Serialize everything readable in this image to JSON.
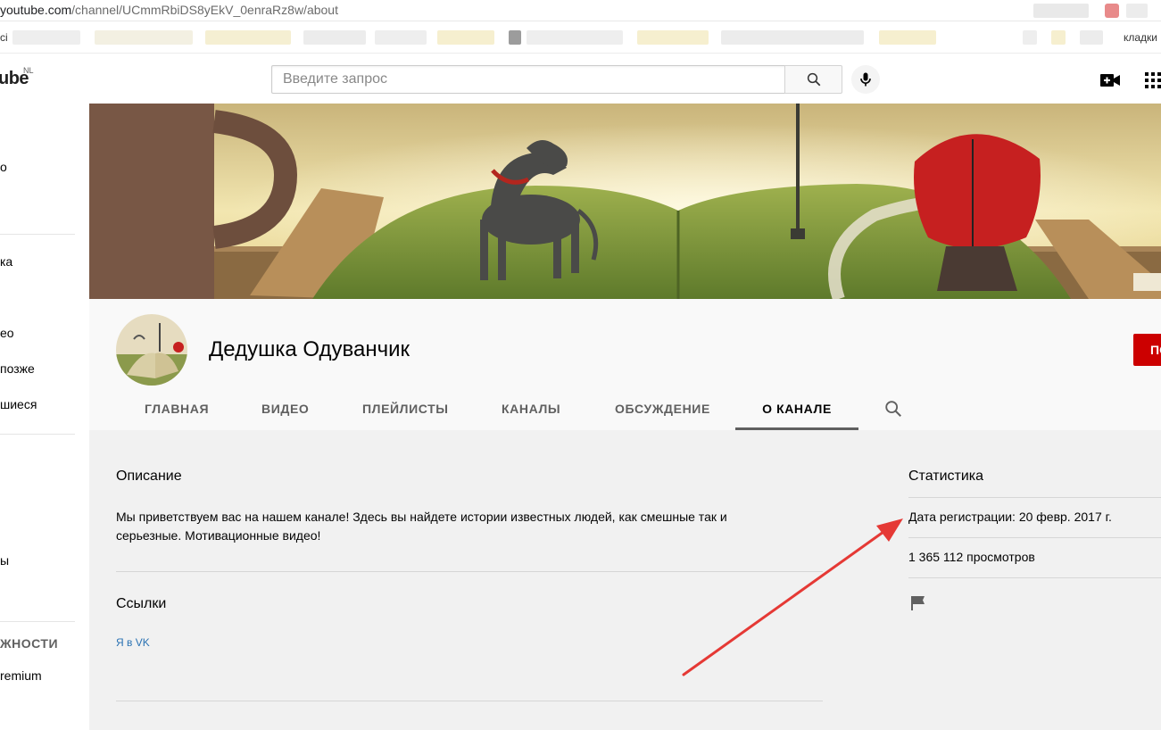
{
  "browser": {
    "url_host": "youtube.com",
    "url_path": "/channel/UCmmRbiDS8yEkV_0enraRz8w/about",
    "bookmarks_start": "ci",
    "bookmarks_end": "кладки"
  },
  "masthead": {
    "logo_text": "ube",
    "logo_region": "NL",
    "search_placeholder": "Введите запрос",
    "search_icon": "search-icon",
    "mic_icon": "mic-icon",
    "create_icon": "video-camera-icon",
    "apps_icon": "apps-grid-icon"
  },
  "sidebar": {
    "items": [
      {
        "label": "о"
      },
      {
        "label": "ка"
      },
      {
        "label": "ео"
      },
      {
        "label": "позже"
      },
      {
        "label": "шиеся"
      },
      {
        "label": "ы"
      }
    ],
    "section_title": "ЖНОСТИ",
    "premium_label": "remium"
  },
  "channel": {
    "name": "Дедушка Одуванчик",
    "subscribe_label": "ПО",
    "tabs": [
      {
        "label": "ГЛАВНАЯ"
      },
      {
        "label": "ВИДЕО"
      },
      {
        "label": "ПЛЕЙЛИСТЫ"
      },
      {
        "label": "КАНАЛЫ"
      },
      {
        "label": "ОБСУЖДЕНИЕ"
      },
      {
        "label": "О КАНАЛЕ"
      }
    ],
    "active_tab": "О КАНАЛЕ"
  },
  "about": {
    "description_title": "Описание",
    "description_text": "Мы приветствуем вас на нашем канале! Здесь вы найдете истории известных людей, как смешные так и серьезные. Мотивационные видео!",
    "links_title": "Ссылки",
    "link_label": "Я в VK",
    "stats_title": "Статистика",
    "registration": "Дата регистрации: 20 февр. 2017 г.",
    "views": "1 365 112 просмотров",
    "flag_icon": "flag-icon"
  },
  "colors": {
    "subscribe": "#cc0000",
    "link": "#2a72b3",
    "annotation_arrow": "#e53935"
  }
}
